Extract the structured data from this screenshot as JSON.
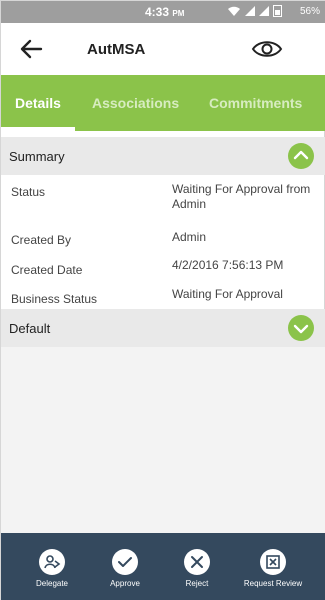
{
  "status_bar": {
    "time": "4:33",
    "ampm": "PM",
    "battery": "56%"
  },
  "header": {
    "title": "AutMSA",
    "back_icon": "arrow-left-icon",
    "view_icon": "eye-icon"
  },
  "tabs": [
    {
      "label": "Details",
      "active": true
    },
    {
      "label": "Associations",
      "active": false
    },
    {
      "label": "Commitments",
      "active": false
    }
  ],
  "summary": {
    "title": "Summary",
    "rows": [
      {
        "label": "Status",
        "value": "Waiting For Approval from Admin"
      },
      {
        "label": "Created By",
        "value": "Admin"
      },
      {
        "label": "Created Date",
        "value": "4/2/2016 7:56:13 PM"
      },
      {
        "label": "Business Status",
        "value": "Waiting For Approval"
      }
    ]
  },
  "default_section": {
    "title": "Default"
  },
  "actions": [
    {
      "label": "Delegate",
      "icon": "delegate-icon"
    },
    {
      "label": "Approve",
      "icon": "check-icon"
    },
    {
      "label": "Reject",
      "icon": "x-icon"
    },
    {
      "label": "Request Review",
      "icon": "review-icon"
    }
  ],
  "colors": {
    "accent": "#8bc34a",
    "action_bar": "#34495e",
    "section_bg": "#e9e9e9"
  }
}
